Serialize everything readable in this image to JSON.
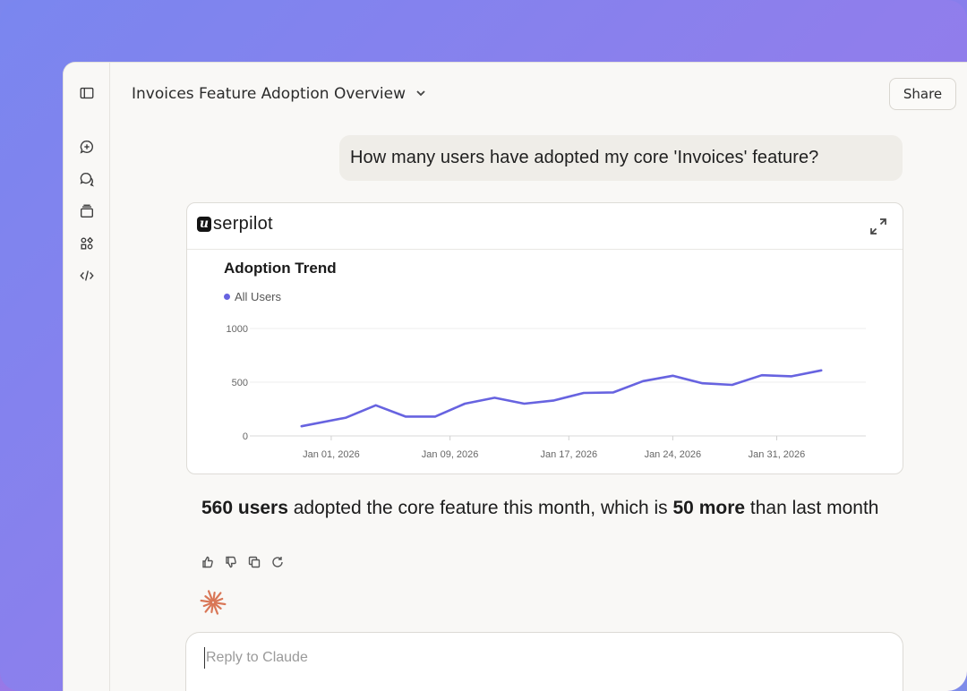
{
  "header": {
    "title": "Invoices Feature Adoption Overview",
    "share_label": "Share"
  },
  "rail": {
    "icons": [
      "sidebar-toggle-icon",
      "new-chat-icon",
      "chats-icon",
      "projects-icon",
      "artifacts-icon",
      "code-icon"
    ]
  },
  "conversation": {
    "user_message": "How many users have adopted my core 'Invoices' feature?",
    "card": {
      "brand_mark": "u",
      "brand_name": "serpilot"
    },
    "answer": {
      "count_bold": "560 users",
      "middle": " adopted the core feature this month, which is ",
      "delta_bold": "50 more",
      "tail": " than last month"
    }
  },
  "reply": {
    "placeholder": "Reply to Claude"
  },
  "colors": {
    "series": "#6763e0",
    "accent_spark": "#d97757"
  },
  "chart_data": {
    "type": "line",
    "title": "Adoption Trend",
    "series": [
      {
        "name": "All Users",
        "x": [
          "2025-12-30",
          "2026-01-02",
          "2026-01-04",
          "2026-01-06",
          "2026-01-08",
          "2026-01-10",
          "2026-01-12",
          "2026-01-14",
          "2026-01-16",
          "2026-01-18",
          "2026-01-20",
          "2026-01-22",
          "2026-01-24",
          "2026-01-26",
          "2026-01-28",
          "2026-01-30",
          "2026-02-01",
          "2026-02-03"
        ],
        "values": [
          90,
          170,
          285,
          180,
          180,
          300,
          355,
          300,
          330,
          400,
          405,
          510,
          560,
          490,
          475,
          565,
          555,
          610
        ]
      }
    ],
    "x_tick_labels": [
      "Jan 01, 2026",
      "Jan 09, 2026",
      "Jan 17, 2026",
      "Jan 24, 2026",
      "Jan 31, 2026"
    ],
    "x_tick_dates": [
      "2026-01-01",
      "2026-01-09",
      "2026-01-17",
      "2026-01-24",
      "2026-01-31"
    ],
    "y_ticks": [
      0,
      500,
      1000
    ],
    "ylim": [
      0,
      1000
    ],
    "xlim": [
      "2025-12-27",
      "2026-02-06"
    ],
    "grid": true,
    "legend": "top-left"
  }
}
